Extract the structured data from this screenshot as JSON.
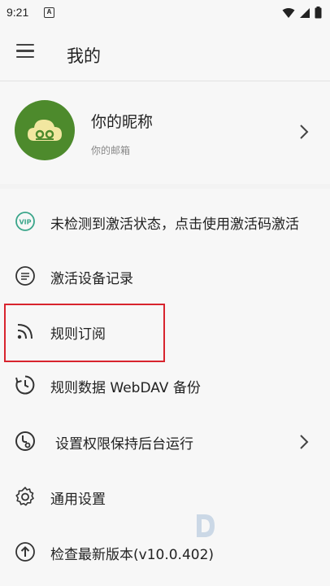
{
  "status_bar": {
    "time": "9:21",
    "notif_letter": "A"
  },
  "app_bar": {
    "title": "我的",
    "menu_icon": "hamburger-menu-icon"
  },
  "profile": {
    "nickname": "你的昵称",
    "email": "你的邮箱",
    "avatar_icon": "cloud-logo-icon",
    "avatar_color": "#4d8a2c"
  },
  "menu": {
    "items": [
      {
        "icon": "vip-icon",
        "label": "未检测到激活状态，点击使用激活码激活"
      },
      {
        "icon": "list-icon",
        "label": "激活设备记录"
      },
      {
        "icon": "rss-icon",
        "label": "规则订阅"
      },
      {
        "icon": "history-icon",
        "label": "规则数据 WebDAV 备份"
      },
      {
        "icon": "background-run-icon",
        "label": "设置权限保持后台运行"
      },
      {
        "icon": "gear-icon",
        "label": "通用设置"
      },
      {
        "icon": "upload-icon",
        "label": "检查最新版本(v10.0.402)"
      }
    ]
  },
  "colors": {
    "vip_accent": "#3aa58a",
    "highlight": "#d8242e"
  }
}
